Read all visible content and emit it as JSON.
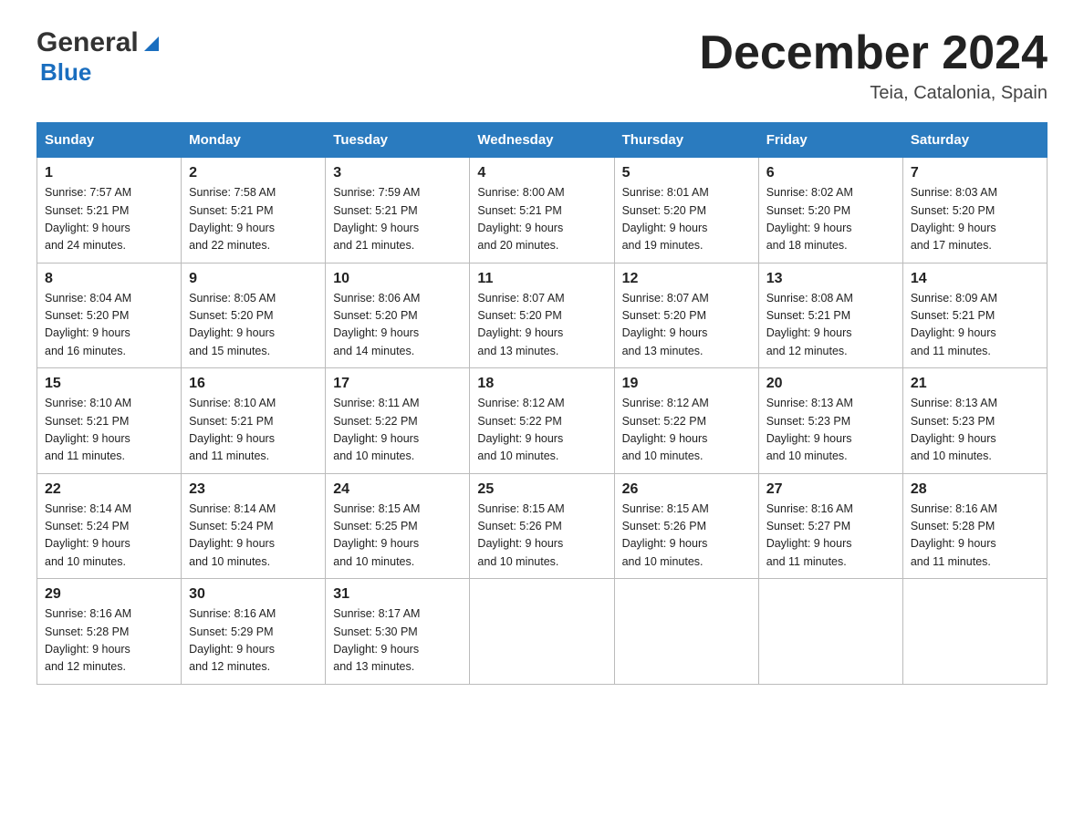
{
  "header": {
    "logo_general": "General",
    "logo_blue": "Blue",
    "month_title": "December 2024",
    "location": "Teia, Catalonia, Spain"
  },
  "weekdays": [
    "Sunday",
    "Monday",
    "Tuesday",
    "Wednesday",
    "Thursday",
    "Friday",
    "Saturday"
  ],
  "weeks": [
    [
      {
        "day": "1",
        "sunrise": "Sunrise: 7:57 AM",
        "sunset": "Sunset: 5:21 PM",
        "daylight": "Daylight: 9 hours",
        "daylight2": "and 24 minutes."
      },
      {
        "day": "2",
        "sunrise": "Sunrise: 7:58 AM",
        "sunset": "Sunset: 5:21 PM",
        "daylight": "Daylight: 9 hours",
        "daylight2": "and 22 minutes."
      },
      {
        "day": "3",
        "sunrise": "Sunrise: 7:59 AM",
        "sunset": "Sunset: 5:21 PM",
        "daylight": "Daylight: 9 hours",
        "daylight2": "and 21 minutes."
      },
      {
        "day": "4",
        "sunrise": "Sunrise: 8:00 AM",
        "sunset": "Sunset: 5:21 PM",
        "daylight": "Daylight: 9 hours",
        "daylight2": "and 20 minutes."
      },
      {
        "day": "5",
        "sunrise": "Sunrise: 8:01 AM",
        "sunset": "Sunset: 5:20 PM",
        "daylight": "Daylight: 9 hours",
        "daylight2": "and 19 minutes."
      },
      {
        "day": "6",
        "sunrise": "Sunrise: 8:02 AM",
        "sunset": "Sunset: 5:20 PM",
        "daylight": "Daylight: 9 hours",
        "daylight2": "and 18 minutes."
      },
      {
        "day": "7",
        "sunrise": "Sunrise: 8:03 AM",
        "sunset": "Sunset: 5:20 PM",
        "daylight": "Daylight: 9 hours",
        "daylight2": "and 17 minutes."
      }
    ],
    [
      {
        "day": "8",
        "sunrise": "Sunrise: 8:04 AM",
        "sunset": "Sunset: 5:20 PM",
        "daylight": "Daylight: 9 hours",
        "daylight2": "and 16 minutes."
      },
      {
        "day": "9",
        "sunrise": "Sunrise: 8:05 AM",
        "sunset": "Sunset: 5:20 PM",
        "daylight": "Daylight: 9 hours",
        "daylight2": "and 15 minutes."
      },
      {
        "day": "10",
        "sunrise": "Sunrise: 8:06 AM",
        "sunset": "Sunset: 5:20 PM",
        "daylight": "Daylight: 9 hours",
        "daylight2": "and 14 minutes."
      },
      {
        "day": "11",
        "sunrise": "Sunrise: 8:07 AM",
        "sunset": "Sunset: 5:20 PM",
        "daylight": "Daylight: 9 hours",
        "daylight2": "and 13 minutes."
      },
      {
        "day": "12",
        "sunrise": "Sunrise: 8:07 AM",
        "sunset": "Sunset: 5:20 PM",
        "daylight": "Daylight: 9 hours",
        "daylight2": "and 13 minutes."
      },
      {
        "day": "13",
        "sunrise": "Sunrise: 8:08 AM",
        "sunset": "Sunset: 5:21 PM",
        "daylight": "Daylight: 9 hours",
        "daylight2": "and 12 minutes."
      },
      {
        "day": "14",
        "sunrise": "Sunrise: 8:09 AM",
        "sunset": "Sunset: 5:21 PM",
        "daylight": "Daylight: 9 hours",
        "daylight2": "and 11 minutes."
      }
    ],
    [
      {
        "day": "15",
        "sunrise": "Sunrise: 8:10 AM",
        "sunset": "Sunset: 5:21 PM",
        "daylight": "Daylight: 9 hours",
        "daylight2": "and 11 minutes."
      },
      {
        "day": "16",
        "sunrise": "Sunrise: 8:10 AM",
        "sunset": "Sunset: 5:21 PM",
        "daylight": "Daylight: 9 hours",
        "daylight2": "and 11 minutes."
      },
      {
        "day": "17",
        "sunrise": "Sunrise: 8:11 AM",
        "sunset": "Sunset: 5:22 PM",
        "daylight": "Daylight: 9 hours",
        "daylight2": "and 10 minutes."
      },
      {
        "day": "18",
        "sunrise": "Sunrise: 8:12 AM",
        "sunset": "Sunset: 5:22 PM",
        "daylight": "Daylight: 9 hours",
        "daylight2": "and 10 minutes."
      },
      {
        "day": "19",
        "sunrise": "Sunrise: 8:12 AM",
        "sunset": "Sunset: 5:22 PM",
        "daylight": "Daylight: 9 hours",
        "daylight2": "and 10 minutes."
      },
      {
        "day": "20",
        "sunrise": "Sunrise: 8:13 AM",
        "sunset": "Sunset: 5:23 PM",
        "daylight": "Daylight: 9 hours",
        "daylight2": "and 10 minutes."
      },
      {
        "day": "21",
        "sunrise": "Sunrise: 8:13 AM",
        "sunset": "Sunset: 5:23 PM",
        "daylight": "Daylight: 9 hours",
        "daylight2": "and 10 minutes."
      }
    ],
    [
      {
        "day": "22",
        "sunrise": "Sunrise: 8:14 AM",
        "sunset": "Sunset: 5:24 PM",
        "daylight": "Daylight: 9 hours",
        "daylight2": "and 10 minutes."
      },
      {
        "day": "23",
        "sunrise": "Sunrise: 8:14 AM",
        "sunset": "Sunset: 5:24 PM",
        "daylight": "Daylight: 9 hours",
        "daylight2": "and 10 minutes."
      },
      {
        "day": "24",
        "sunrise": "Sunrise: 8:15 AM",
        "sunset": "Sunset: 5:25 PM",
        "daylight": "Daylight: 9 hours",
        "daylight2": "and 10 minutes."
      },
      {
        "day": "25",
        "sunrise": "Sunrise: 8:15 AM",
        "sunset": "Sunset: 5:26 PM",
        "daylight": "Daylight: 9 hours",
        "daylight2": "and 10 minutes."
      },
      {
        "day": "26",
        "sunrise": "Sunrise: 8:15 AM",
        "sunset": "Sunset: 5:26 PM",
        "daylight": "Daylight: 9 hours",
        "daylight2": "and 10 minutes."
      },
      {
        "day": "27",
        "sunrise": "Sunrise: 8:16 AM",
        "sunset": "Sunset: 5:27 PM",
        "daylight": "Daylight: 9 hours",
        "daylight2": "and 11 minutes."
      },
      {
        "day": "28",
        "sunrise": "Sunrise: 8:16 AM",
        "sunset": "Sunset: 5:28 PM",
        "daylight": "Daylight: 9 hours",
        "daylight2": "and 11 minutes."
      }
    ],
    [
      {
        "day": "29",
        "sunrise": "Sunrise: 8:16 AM",
        "sunset": "Sunset: 5:28 PM",
        "daylight": "Daylight: 9 hours",
        "daylight2": "and 12 minutes."
      },
      {
        "day": "30",
        "sunrise": "Sunrise: 8:16 AM",
        "sunset": "Sunset: 5:29 PM",
        "daylight": "Daylight: 9 hours",
        "daylight2": "and 12 minutes."
      },
      {
        "day": "31",
        "sunrise": "Sunrise: 8:17 AM",
        "sunset": "Sunset: 5:30 PM",
        "daylight": "Daylight: 9 hours",
        "daylight2": "and 13 minutes."
      },
      null,
      null,
      null,
      null
    ]
  ]
}
